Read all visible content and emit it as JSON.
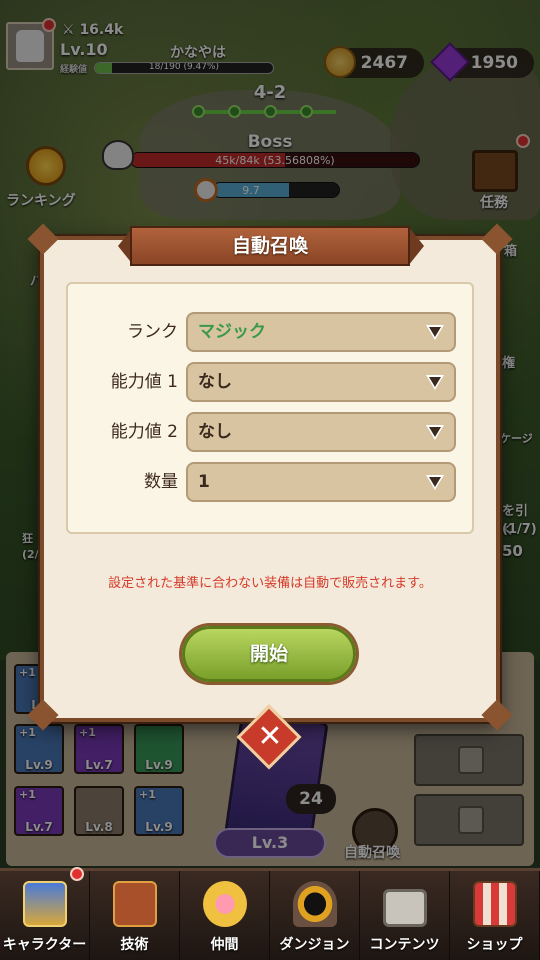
{
  "player": {
    "power": "16.4k",
    "level": "Lv.10",
    "name": "かなやは",
    "xp_label": "経験値",
    "xp_progress": "18/190 (9.47%)",
    "xp_fraction": 0.0947
  },
  "currency": {
    "gold": "2467",
    "gems": "1950"
  },
  "stage": {
    "label": "4-2"
  },
  "boss": {
    "label": "Boss",
    "hp": "45k/84k (53.56808%)",
    "hp_fraction": 0.5357
  },
  "timer": {
    "value": "9.7"
  },
  "side": {
    "ranking": "ランキング",
    "missions": "任務",
    "peek_right_1": "パ",
    "peek_right_2": "箱",
    "peek_right_3": "権",
    "peek_right_4": "ケージ",
    "peek_right_5": "を引く",
    "peek_right_6": "(1/7)",
    "peek_right_7": "50",
    "peek_left_1": "狂",
    "peek_left_2": "(2/"
  },
  "dialog": {
    "title": "自動召喚",
    "fields": [
      {
        "label": "ランク",
        "value": "マジック"
      },
      {
        "label": "能力値 1",
        "value": "なし"
      },
      {
        "label": "能力値 2",
        "value": "なし"
      },
      {
        "label": "数量",
        "value": "1"
      }
    ],
    "warning": "設定された基準に合わない装備は自動で販売されます。",
    "start_label": "開始",
    "close_glyph": "✕"
  },
  "inventory": {
    "items": [
      {
        "level": "Lv.9",
        "plus": "+1"
      },
      {
        "level": "Lv.7",
        "plus": "+1"
      },
      {
        "level": "Lv.9",
        "plus": ""
      },
      {
        "level": "Lv.7",
        "plus": "+1"
      },
      {
        "level": "Lv.8",
        "plus": ""
      },
      {
        "level": "Lv.9",
        "plus": "+1"
      },
      {
        "level": "Lv",
        "plus": "+1"
      }
    ],
    "draw_count": "24",
    "summon_level": "Lv.3",
    "auto_summon_label": "自動召喚"
  },
  "nav": {
    "items": [
      {
        "label": "キャラクター",
        "icon": "character-card-icon"
      },
      {
        "label": "技術",
        "icon": "skill-book-icon"
      },
      {
        "label": "仲間",
        "icon": "paw-icon"
      },
      {
        "label": "ダンジョン",
        "icon": "dungeon-portal-icon"
      },
      {
        "label": "コンテンツ",
        "icon": "lock-icon"
      },
      {
        "label": "ショップ",
        "icon": "shop-stall-icon"
      }
    ]
  },
  "colors": {
    "accent_green": "#7aa02a",
    "warning_red": "#d63a2a",
    "magic_green": "#3a9a4a",
    "dialog_border": "#7a4a2a"
  }
}
